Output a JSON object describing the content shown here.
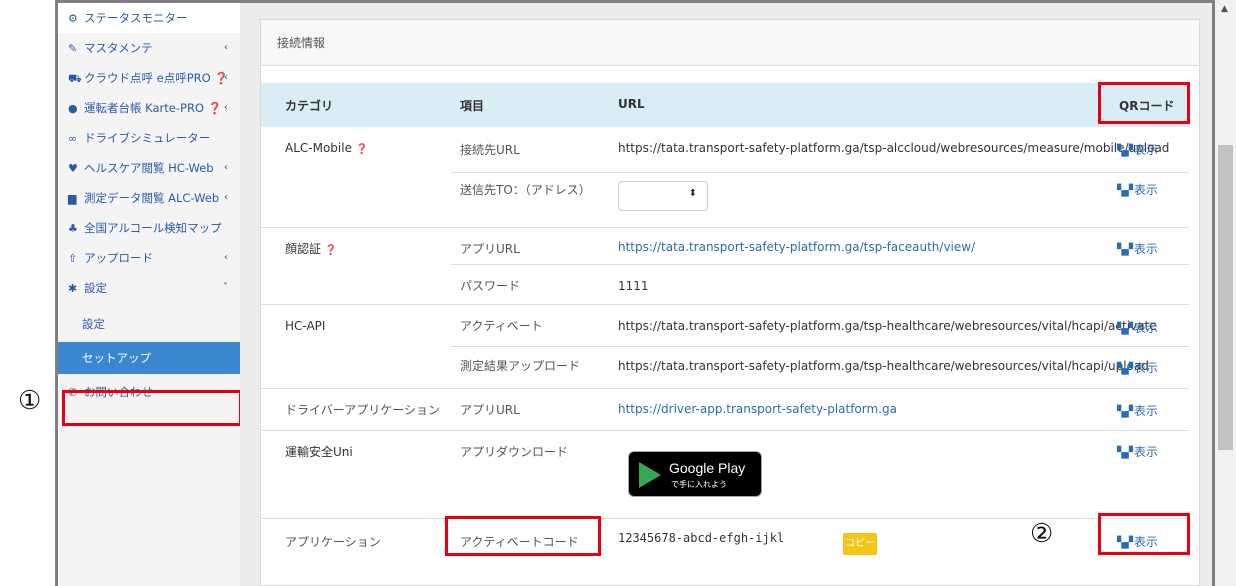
{
  "sidebar": {
    "items": [
      {
        "icon": "dashboard-icon",
        "glyph": "⚙",
        "label": "ステータスモニター"
      },
      {
        "icon": "wrench-icon",
        "glyph": "✎",
        "label": "マスタメンテ",
        "chevron": "‹"
      },
      {
        "icon": "truck-icon",
        "glyph": "⛟",
        "label": "クラウド点呼 e点呼PRO ❓",
        "chevron": "‹"
      },
      {
        "icon": "user-icon",
        "glyph": "●",
        "label": "運転者台帳 Karte-PRO ❓",
        "chevron": "‹"
      },
      {
        "icon": "glasses-icon",
        "glyph": "∞",
        "label": "ドライブシミュレーター"
      },
      {
        "icon": "heart-icon",
        "glyph": "♥",
        "label": "ヘルスケア閲覧 HC-Web",
        "chevron": "‹"
      },
      {
        "icon": "book-icon",
        "glyph": "▆",
        "label": "測定データ閲覧 ALC-Web",
        "chevron": "‹"
      },
      {
        "icon": "map-icon",
        "glyph": "♣",
        "label": "全国アルコール検知マップ"
      },
      {
        "icon": "upload-icon",
        "glyph": "⇧",
        "label": "アップロード",
        "chevron": "‹"
      },
      {
        "icon": "gear-icon",
        "glyph": "✱",
        "label": "設定",
        "chevron": "˅"
      }
    ],
    "sub_items": [
      "設定",
      "セットアップ"
    ],
    "contact": {
      "icon": "phone-icon",
      "glyph": "✆",
      "label": "お問い合わせ"
    }
  },
  "annotations": {
    "one": "①",
    "two": "②"
  },
  "panel": {
    "title": "接続情報",
    "headers": {
      "category": "カテゴリ",
      "item": "項目",
      "url": "URL",
      "qr": "QRコード"
    },
    "qr_label": "表示",
    "rows": [
      {
        "category": "ALC-Mobile",
        "help": "❓",
        "item": "接続先URL",
        "url": "https://tata.transport-safety-platform.ga/tsp-alccloud/webresources/measure/mobile/upload",
        "link": false,
        "qr": true
      },
      {
        "category": "",
        "item": "送信先TO：（アドレス）",
        "url": "",
        "select": true,
        "qr": true
      },
      {
        "category": "顔認証",
        "help": "❓",
        "item": "アプリURL",
        "url": "https://tata.transport-safety-platform.ga/tsp-faceauth/view/",
        "link": true,
        "qr": true
      },
      {
        "category": "",
        "item": "パスワード",
        "url": "1111",
        "link": false,
        "qr": false
      },
      {
        "category": "HC-API",
        "item": "アクティベート",
        "url": "https://tata.transport-safety-platform.ga/tsp-healthcare/webresources/vital/hcapi/activate",
        "link": false,
        "qr": true
      },
      {
        "category": "",
        "item": "測定結果アップロード",
        "url": "https://tata.transport-safety-platform.ga/tsp-healthcare/webresources/vital/hcapi/upload",
        "link": false,
        "qr": true
      },
      {
        "category": "ドライバーアプリケーション",
        "item": "アプリURL",
        "url": "https://driver-app.transport-safety-platform.ga",
        "link": true,
        "qr": true
      },
      {
        "category": "運輸安全Uni",
        "item": "アプリダウンロード",
        "url": "",
        "googleplay": true,
        "qr": true
      },
      {
        "category": "アプリケーション",
        "item": "アクティベートコード",
        "url": "12345678-abcd-efgh-ijkl",
        "copy": true,
        "qr": true
      }
    ],
    "select_arrow": "⬍",
    "googleplay": {
      "title": "Google Play",
      "subtitle": "で手に入れよう"
    },
    "copy_label": "コピー"
  },
  "colors": {
    "accent": "#3b87cf",
    "highlight_box": "#e60012",
    "table_header": "#d9edf7",
    "copy_button": "#f5c518"
  }
}
